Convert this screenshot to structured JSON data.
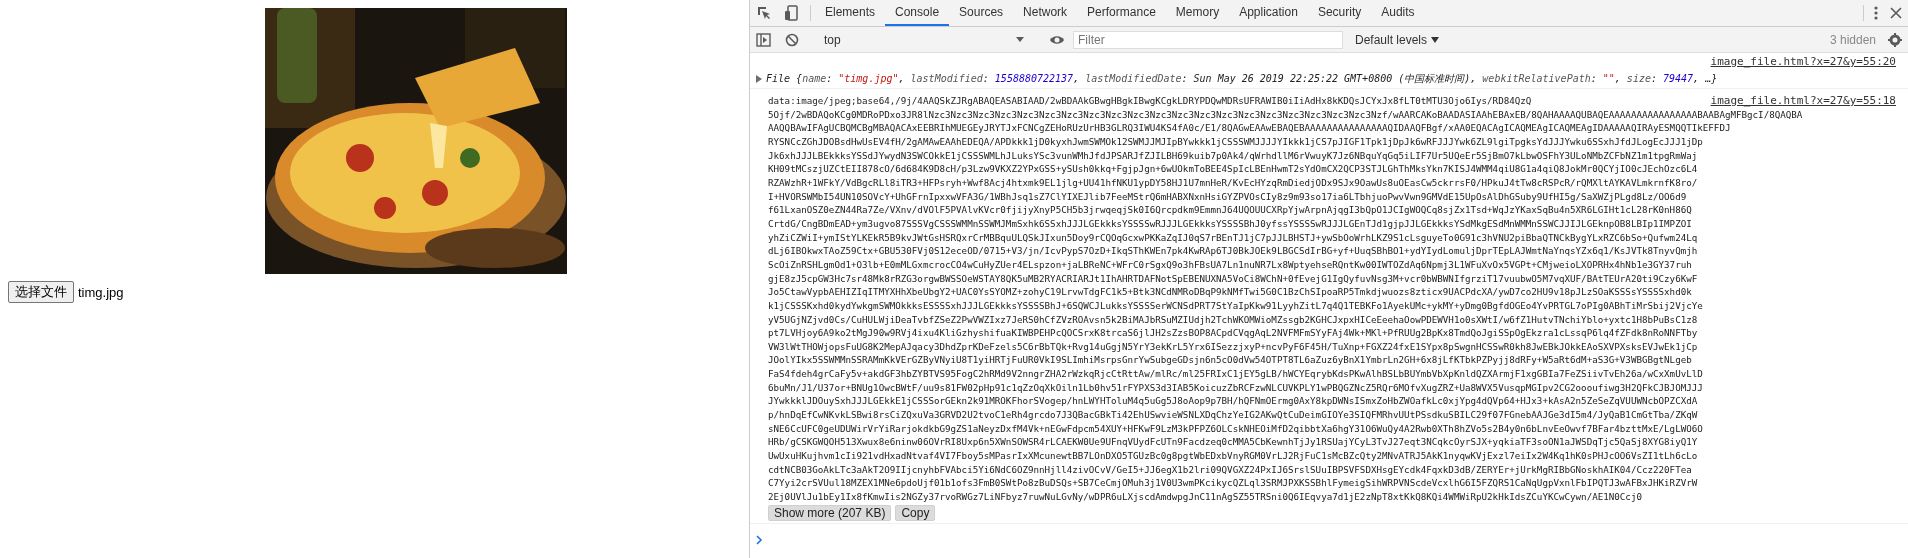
{
  "page": {
    "file_button": "选择文件",
    "file_name": "timg.jpg"
  },
  "devtools": {
    "tabs": [
      {
        "label": "Elements",
        "selected": false
      },
      {
        "label": "Console",
        "selected": true
      },
      {
        "label": "Sources",
        "selected": false
      },
      {
        "label": "Network",
        "selected": false
      },
      {
        "label": "Performance",
        "selected": false
      },
      {
        "label": "Memory",
        "selected": false
      },
      {
        "label": "Application",
        "selected": false
      },
      {
        "label": "Security",
        "selected": false
      },
      {
        "label": "Audits",
        "selected": false
      }
    ],
    "console_toolbar": {
      "context": "top",
      "filter": {
        "placeholder": "Filter"
      },
      "levels": "Default levels",
      "hidden_count": "3 hidden"
    },
    "messages": [
      {
        "kind": "object",
        "source": "image_file.html?x=27&y=55:20",
        "expanded": false,
        "preview": [
          {
            "kind": "class",
            "text": "File "
          },
          {
            "kind": "punct",
            "text": "{"
          },
          {
            "kind": "key",
            "text": "name"
          },
          {
            "kind": "punct",
            "text": ": "
          },
          {
            "kind": "string",
            "text": "\"timg.jpg\""
          },
          {
            "kind": "punct",
            "text": ", "
          },
          {
            "kind": "key",
            "text": "lastModified"
          },
          {
            "kind": "punct",
            "text": ": "
          },
          {
            "kind": "number",
            "text": "1558880722137"
          },
          {
            "kind": "punct",
            "text": ", "
          },
          {
            "kind": "key",
            "text": "lastModifiedDate"
          },
          {
            "kind": "punct",
            "text": ": "
          },
          {
            "kind": "plain",
            "text": "Sun May 26 2019 22:25:22 GMT+0800 (中国标准时间)"
          },
          {
            "kind": "punct",
            "text": ", "
          },
          {
            "kind": "key",
            "text": "webkitRelativePath"
          },
          {
            "kind": "punct",
            "text": ": "
          },
          {
            "kind": "string",
            "text": "\"\""
          },
          {
            "kind": "punct",
            "text": ", "
          },
          {
            "kind": "key",
            "text": "size"
          },
          {
            "kind": "punct",
            "text": ": "
          },
          {
            "kind": "number",
            "text": "79447"
          },
          {
            "kind": "punct",
            "text": ", …}"
          }
        ]
      },
      {
        "kind": "text",
        "source": "image_file.html?x=27&y=55:18",
        "lines": [
          "data:image/jpeg;base64,/9j/4AAQSkZJRgABAQEASABIAAD/2wBDAAkGBwgHBgkIBwgKCgkLDRYPDQwMDRsUFRAWIB0iIiAdHx8kKDQsJCYxJx8fLT0tMTU3Ojo6Iys/RD84QzQ",
          "5Ojf/2wBDAQoKCg0MDRoPDxo3JR8lNzc3Nzc3Nzc3Nzc3Nzc3Nzc3Nzc3Nzc3Nzc3Nzc3Nzc3Nzc3Nzc3Nzc3Nzc3Nzc3Nzc3Nzc3Nzc3Nzc3Nzf/wAARCAKoBAADASIAAhEBAxEB/8QAHAAAAQUBAQEAAAAAAAAAAAAAAAABAABAgMFBgcI/8QAQBA",
          "AAQQBAwIFAgUCBQMCBgMBAQACAxEEBRIhMUEGEyJRYTJxFCNCgZEHoRUzUrHB3GLRQ3IWU4KS4fA0c/E1/8QAGwEAAwEBAQEBAAAAAAAAAAAAAAAQIDAAQFBgf/xAA0EQACAgICAQMEAgICAQMEAgIDAAAAAQIRAyESMQQTIkEFFDJ",
          "RYSNCcZGhJDOBsdHwUsEV4fH/2gAMAwEAAhEDEQA/APDkkk1jD0kyxhJwmSWMOk12SWMJJMJIpBYwkkk1jCSSSWMJJJJYIkkk1jCS7pJIGF1Tpk1jDpJk6wRFJJJYwk6ZL9lgiTpgksYdJJJYwku6SSxhJfdJLogEcJJJ1jDp",
          "Jk6xhJJJLBEkkksYSSdJYwydN3SWCOkkE1jCSSSWMLhJLuksYSc3vunWMhJfdJPSARJfZJILBH69kuib7p0Ak4/qWrhdllM6rVwuyK7Jz6NBquYqGq5iLIF7Ur5UQeEr5SjBmO7kLbwOSFhY3ULoNMbZCFbNZ1m1tpgRmWaj",
          "KH09tMCszjUZCtEII878cO/6d684K9D8cH/p3Lzw9VKXZ2YPxGSS+ySUsh0kkq+FgjpJgn+6wUOkmToBEE4SpIcLBEnHwmT2sYdOmCX2QCP3STJLGhThMksYkn7KISJ4WMM4qiU8G1a4qiQ8JokMr0QCYjIO0cJEchOzc6L4",
          "RZAWzhR+1WFkY/VdBgcRLl8iTR3+HFPsryh+Wwf8Acj4htxmk9EL1jlg+UU41hfNKU1ypDY58HJ1U7mnHeR/KvEcHYzqRmDiedjODx9SJx9OawUs8uOEasCw5ckrrsF0/HPkuJ4tTw8cRSPcR/rQMXltAYKAVLmkrnfK8ro/",
          "I+HVORSWMbI54UN10SOVcY+UhGFrnIpxxwVFA3G/1WBhJsq1sZ7ClYIXEJlib7FeeMStrQ6mHABXNxnHsiGYZPVOsCIy8z9m93so17ia6LTbhjuoPwvVwn9GMVdE15UpOsAlDhGSuby9UfHI5g/SaXWZjPLgd8Lz/OO6d9",
          "f61LxanOSZ0eZN44Ra7Ze/VXnv/dVOlF5PVAlvKVcr0fjijyXnyP5CH5b3jrwqeqjSk0I6Qrcpdkm9EmmnJ64UQOUUCXRpYjwArpnAjqgI3bQpO1JCIgWOQCq8sjZx1Tsd+WqJzYKaxSqBu4n5XR6LGIHt1cL28rK0nH86Q",
          "CrtdG/CngBDmEAD+ym3ugvo87SSSVgCSSSWMMnSSWMJMmSxhk6SSxhJJJLGEkkksYSSSSwRJJJLGEkkksYSSSSBhJ0yfssYSSSSwRJJJLGEnTJd1gjpJJLGEkkksYSdMkgESdMnWMMnSSWCJJIJLGEknpOB8LBIp1IMPZOI",
          "yhZiCZWiI+ymIStYLKEkR5B9kvJWtGsHSRQxrCrMBBquULQSkJIxun5Doy9rCQOqGcxwPKKaZqIJ0qS7rBEnTJ1jC7pJJLBHSTJ+ywSbOoWrhLKZ9S1cLsguyeTo0G91c3hVNU2piBbaQTNCkBygYLxRZC6bSo+Qufwm24Lq",
          "dLj6IBOkwxTAoZ59Ctx+GBU530FVj0S12eceOD/0715+V3/jn/IcvPypS7OzD+IkqSThKWEn7pk4KwRAp6TJ0BkJOEk9LBGCSdIrBG+yf+UuqSBhBO1+ydYIydLomuljDprTEpLAJWmtNaYnqsYZx6q1/KsJVTk8TnyvQmjh",
          "ScOiZnRSHLgmOd1+O3lb+E0mMLGxmcrocCO4wCuHyZUer4ELspzon+jaLBReNC+WFrC0rSgxQ9o3hFBsUA7Ln1nuNR7Lx8WptyehseRQntKw00IWTOZdAq6Npmj3L1WFuXvOx5VGPt+CMjweioLXOPRHx4hNb1e3GY37ruh",
          "gjE8zJ5cpGW3Hc7sr48Mk8rRZG3orgwBWSSOeWSTAY8QK5uMB2RYACRIARJt1IhAHRTDAFNotSpEBENUXNA5VoCi8WChN+0fEvejG1IgQyfuvNsg3M+vcr0bWBWNIfgrziT17vuubwO5M7vqXUF/BAtTEUrA20ti9Czy6KwF",
          "Jo5CtawVypbAEHIZIqITMYXHhXbeUbgY2+UAC0YsSYOMZ+zohyC19LrvwTdgFC1k5+Btk3NCdNMRoDBqP9kNMfTwi5G0C1BzChSIpoaRP5Tmkdjwuozs8zticx9UACPdcXA/ywD7co2HU9v18pJLzSOaKSSSsYSSSSxhd0k",
          "k1jCSSSKxhd0kydYwkgmSWMOkkksESSSSxhJJJLGEkkksYSSSSBhJ+6SQWCJLukksYSSSSerWCNSdPRT7StYaIpKkw91LyyhZitL7q4Q1TEBKFo1AyekUMc+ykMY+yDmg0BgfdOGEo4YvPRTGL7oPIg0ABhTiMrSbij2VjcYe",
          "yV5UGjNZjvd0Cs/CuHULWjiDeaTvbfZSeZ2PwVWZIxz7JeRS0hCfZVzROAvsn5k2BiMAJbRSuMZIUdjh2TchWKOMWioMZssgb2KGHCJxpxHICeEeehaOowPDEWVH1o0sXWtI/w6fZ1HutvTNchiYblo+yxtc1H8bPuBsC1z8",
          "pt7LVHjoy6A9ko2tMgJ90w9RVj4ixu4KliGzhyshifuaKIWBPEHPcQOCSrxK8trcaS6jlJH2sZzsBOP8ACpdCVqgAqL2NVFMFmSYyFAj4Wk+MKl+PfRUUg2BpKx8TmdQoJgiSSpOgEkzra1cLssqP6lq4fZFdk8nRoNNFTby",
          "VW3lWtTHOWjopsFuUG8K2MepAJqacy3DhdZprKDeFzels5C6rBbTQk+Rvg14uGgjN5YrY3ekKrL5Yrx6ISezzjxyP+ncvPyF6F45H/TuXnp+FGXZ24fxE1SYpx8pSwgnHCSSwR0kh8JwEBkJOkkEAoSXVPXsksEVJwEk1jCp",
          "JOolYIkx5SSWMMnSSRAMmKkVErGZByVNyiU8T1yiHRTjFuUR0VkI9SLImhiMsrpsGnrYwSubgeGDsjn6n5cO0dVw54OTPT8TL6aZuz6yBnX1YmbrLn2GH+6x8jLfKTbkPZPyjj8dRFy+W5aRt6dM+aS3G+V3WBGBgtNLgeb",
          "FaS4fdeh4grCaFy5v+akdGF3hbZYBTVS95FogC2hRMd9V2nngrZHA2rWzkqRjcCtRttAw/mlRc/ml25FRIxC1jEY5gLB/hWCYEqrybKdsPKwAlhBSLbBUYmbVbXpKnldQZXArmjF1xgGBIa7FeZSiivTvEh26a/wCxXmUvLlD",
          "6buMn/J1/U37or+BNUg1OwcBWtF/uu9s81FW02pHp91c1qZzOqXkOiln1Lb0hv51rFYPXS3d3IAB5KoicuzZbRCFzwNLCUVKPLY1wPBQGZNcZ5RQr6MOfvXugZRZ+Ua8WVX5VusqpMGIpv2CG2oooufiwg3H2QFkCJBJOMJJJ",
          "JYwkkklJDOuySxhJJJLGEkkE1jCSSSorGEkn2k91MROKFhorSVogep/hnLWYHToluM4q5uGg5J8oAop9p7BH/hQFNmOErmg0AxY8kpDWNsISmxZoHbZWOafkLc0xjYpg4dQVp64+HJx3+kAsA2n5ZeSeZqVUUWNcbOPZCXdA",
          "p/hnDqEfCwNKvkLSBwi8rsCiZQxuVa3GRVD2U2tvoC1eRh4grcdo7J3QBacGBkTi42EhUSwvieWSNLXDqChzYeIG2AKwQtCuDeimGIOYe3SIQFMRhvUUtPSsdkuSBILC29f07FGnebAAJGe3dI5m4/JyQaB1CmGtTba/ZKqW",
          "sNE6CcUFC0geUDUWirVrYiRarjokdkbG9gZS1aNeyzDxfM4Vk+nEGwFdpcm54XUY+HFKwF9LzM3kPFPZ6OLCskNHEOiMfD2qibbtXa6hgY31O6WuQy4A2Rwb0XTh8hZVo5s2B4y0n6bLnvEeOwvf7BFar4bzttMxE/LgLWO6O",
          "HRb/gCSKGWQOH513Xwux8e6ninw06OVrRI8Uxp6n5XWnSOWSR4rLCAEKW0Ue9UFnqVUydFcUTn9Facdzeq0cMMA5CbKewnhTjJy1RSUajYCyL3TvJ27eqt3NCqkcOyrSJX+yqkiaTF3soON1aJWSDqTjc5QaSj8XYG8iyQ1Y",
          "UwUxuHKujhvm1cIi921vdHxadNtvaf4VI7Fboy5sMPasrIxXMcunewtBB7LOnDXO5TGUzBc0g8pgtWbEDxbVnyRGM0VrLJ2RjFuC1sMcBZcQty2MNvATRJ5AkK1nyqwKVjExzl7eiIx2W4Kq1hK0sPHJcOO6VsZI1tLh6cLo",
          "cdtNCB03GoAkLTc3aAkT2O9IIjcnyhbFVAbci5Yi6NdC6OZ9nnHjll4zivOCvV/GeI5+JJ6egX1b2lri09QVGXZ24PxIJ6SrslSUuIBPSVFSDXHsgEYcdk4FqxkD3dB/ZERYEr+jUrkMgRIBbGNoskhAIK04/Ccz220FTea",
          "C7Yyi2crSVUul18MZEX1MNe6pdoUjf01b1ofs3FmB0SWtPo8zBuDSQs+SB7CeCmjOMuh3j1V0U3wmPKcikycQZLql3SRMJPXKSSBhlFymeigSihWRPVNScdeVcxlhG6I5FZQRS1CaNqUgpVxnlFbIPQTJ3wAFBxJHKiRZVrW",
          "2Ej0UVlJu1bEy1Ix8fKmwIis2NGZy37rvoRWGz7LiNFbyz7ruwNuLGvNy/wDPR6uLXjscdAmdwpgJnC11nAgSZ55TRSni0Q6IEqvya7d1jE2zNpT8xtKkQ8KQi4WMWiRpU2kHkIdsZCuYKCwCywn/AE1N0Ccj0"
        ],
        "buttons": [
          "Show more (207 KB)",
          "Copy"
        ]
      }
    ]
  }
}
